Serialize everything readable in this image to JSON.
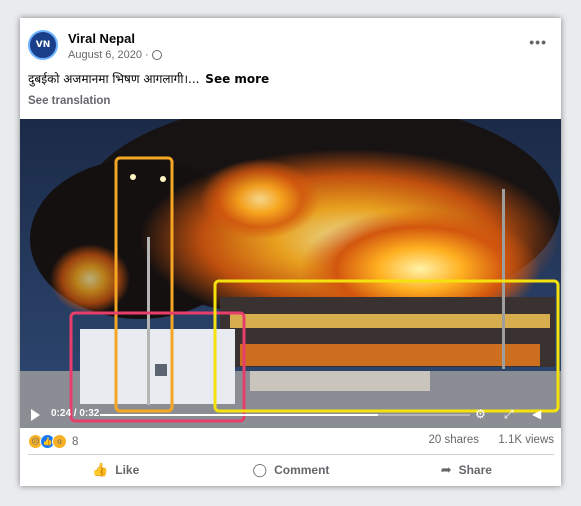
{
  "post": {
    "author": "Viral Nepal",
    "avatar_text": "VN",
    "date": "August 6, 2020",
    "date_separator": "·",
    "privacy_icon": "globe-icon",
    "more_icon": "•••",
    "caption": "दुबईको अजमानमा भिषण आगलागी।...",
    "see_more": "See more",
    "see_translation": "See translation"
  },
  "video": {
    "timecode": "0:24 / 0:32",
    "progress": 0.75,
    "icons": [
      "play-icon",
      "settings-icon",
      "fullscreen-icon",
      "volume-icon"
    ],
    "annotation_colors": {
      "orange": "#f5a623",
      "pink": "#e83e6c",
      "yellow": "#f4e20e"
    }
  },
  "stats": {
    "reaction_count": "8",
    "reactions": [
      "sad",
      "like",
      "wow"
    ],
    "shares": "20 shares",
    "views": "1.1K views"
  },
  "actions": {
    "like": "Like",
    "comment": "Comment",
    "share": "Share"
  },
  "colors": {
    "text": "#050505",
    "muted": "#65676b",
    "like_blue": "#1877f2"
  }
}
